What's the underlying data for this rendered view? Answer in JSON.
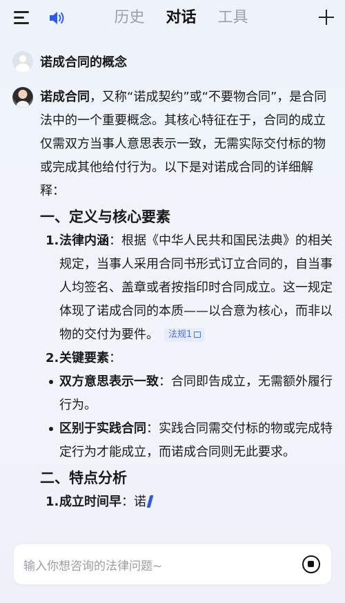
{
  "header": {
    "tabs": [
      {
        "label": "历史",
        "active": false
      },
      {
        "label": "对话",
        "active": true
      },
      {
        "label": "工具",
        "active": false
      }
    ],
    "icons": [
      "menu-icon",
      "speaker-icon",
      "plus-icon"
    ],
    "accent_color": "#2f5bea"
  },
  "question": {
    "text": "诺成合同的概念"
  },
  "answer": {
    "intro_term": "诺成合同",
    "intro_rest": "，又称“诺成契约”或“不要物合同”，是合同法中的一个重要概念。其核心特征在于，合同的成立仅需双方当事人意思表示一致，无需实际交付标的物或完成其他给付行为。以下是对诺成合同的详细解释：",
    "section1_title": "一、定义与核心要素",
    "item1_num": "1.",
    "item1_term": "法律内涵",
    "item1_text": "：根据《中华人民共和国民法典》的相关规定，当事人采用合同书形式订立合同的，自当事人均签名、盖章或者按指印时合同成立。这一规定体现了诺成合同的本质——以合意为核心，而非以物的交付为要件。",
    "law_tag": "法规1",
    "item2_num": "2.",
    "item2_term": "关键要素",
    "item2_text": "：",
    "bullet1_term": "双方意思表示一致",
    "bullet1_text": "：合同即告成立，无需额外履行行为。",
    "bullet2_term": "区别于实践合同",
    "bullet2_text": "：实践合同需交付标的物或完成特定行为才能成立，而诺成合同则无此要求。",
    "section2_title": "二、特点分析",
    "item3_num": "1.",
    "item3_term": "成立时间早",
    "item3_text": "：诺"
  },
  "input": {
    "placeholder": "输入你想咨询的法律问题~"
  }
}
